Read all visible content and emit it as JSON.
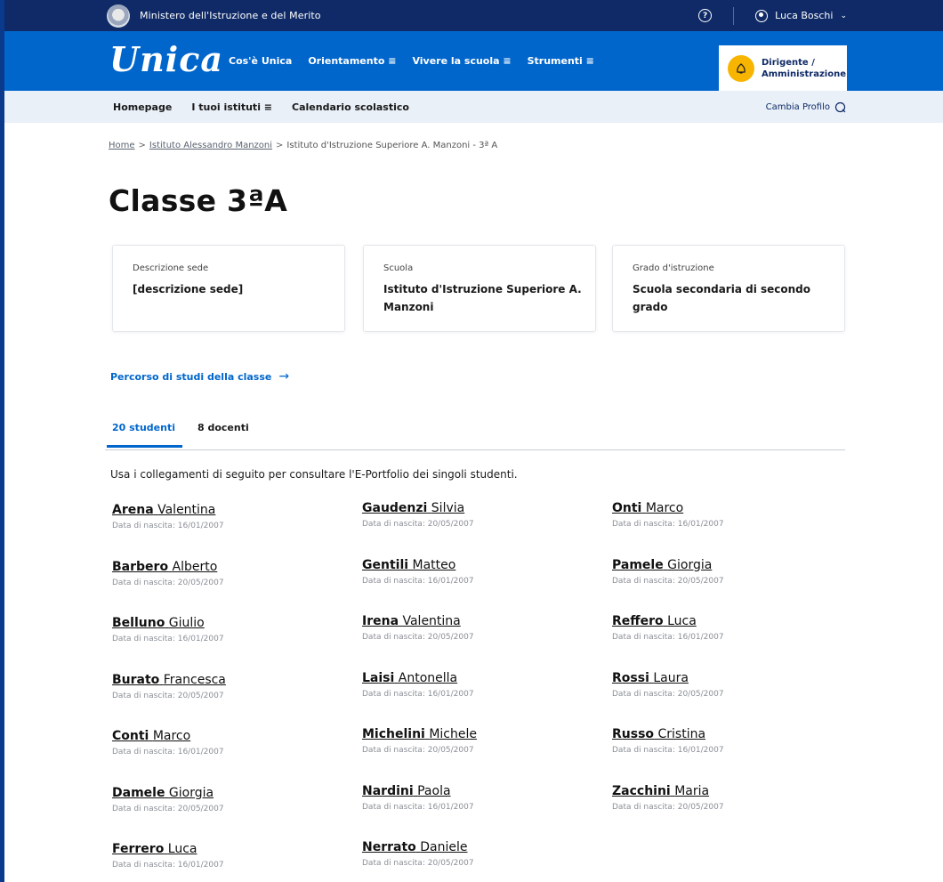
{
  "topbar": {
    "ministry": "Ministero dell'Istruzione e del Merito",
    "help_icon": "?",
    "user": "Luca Boschi",
    "user_chevron": "⌄"
  },
  "header": {
    "logo": "Unica",
    "nav": [
      "Cos'è Unica",
      "Orientamento ≡",
      "Vivere la scuola ≡",
      "Strumenti ≡"
    ],
    "profile_line1": "Dirigente /",
    "profile_line2": "Amministrazione"
  },
  "subnav": {
    "items": [
      "Homepage",
      "I tuoi istituti ≡",
      "Calendario scolastico"
    ],
    "cambia": "Cambia Profilo"
  },
  "breadcrumb": {
    "home": "Home",
    "istituto": "Istituto Alessandro Manzoni",
    "current": "Istituto d'Istruzione Superiore A. Manzoni - 3ª A",
    "sep": ">"
  },
  "page_title": "Classe 3ªA",
  "cards": [
    {
      "label": "Descrizione sede",
      "value": "[descrizione sede]"
    },
    {
      "label": "Scuola",
      "value": "Istituto d'Istruzione Superiore A. Manzoni"
    },
    {
      "label": "Grado d'istruzione",
      "value": "Scuola secondaria di secondo grado"
    }
  ],
  "percorso": {
    "label": "Percorso di studi della classe",
    "arrow": "→"
  },
  "tabs": {
    "students": "20 studenti",
    "teachers": "8 docenti"
  },
  "intro": "Usa i collegamenti di seguito per consultare l'E-Portfolio dei singoli studenti.",
  "students": {
    "col1": [
      {
        "surname": "Arena",
        "name": "Valentina",
        "dob": "Data di nascita: 16/01/2007"
      },
      {
        "surname": "Barbero",
        "name": "Alberto",
        "dob": "Data di nascita: 20/05/2007"
      },
      {
        "surname": "Belluno",
        "name": "Giulio",
        "dob": "Data di nascita: 16/01/2007"
      },
      {
        "surname": "Burato",
        "name": "Francesca",
        "dob": "Data di nascita: 20/05/2007"
      },
      {
        "surname": "Conti",
        "name": "Marco",
        "dob": "Data di nascita: 16/01/2007"
      },
      {
        "surname": "Damele",
        "name": "Giorgia",
        "dob": "Data di nascita: 20/05/2007"
      },
      {
        "surname": "Ferrero",
        "name": "Luca",
        "dob": "Data di nascita: 16/01/2007"
      }
    ],
    "col2": [
      {
        "surname": "Gaudenzi",
        "name": "Silvia",
        "dob": "Data di nascita: 20/05/2007"
      },
      {
        "surname": "Gentili",
        "name": "Matteo",
        "dob": "Data di nascita: 16/01/2007"
      },
      {
        "surname": "Irena",
        "name": "Valentina",
        "dob": "Data di nascita: 20/05/2007"
      },
      {
        "surname": "Laisi",
        "name": "Antonella",
        "dob": "Data di nascita: 16/01/2007"
      },
      {
        "surname": "Michelini",
        "name": "Michele",
        "dob": "Data di nascita: 20/05/2007"
      },
      {
        "surname": "Nardini",
        "name": "Paola",
        "dob": "Data di nascita: 16/01/2007"
      },
      {
        "surname": "Nerrato",
        "name": "Daniele",
        "dob": "Data di nascita: 20/05/2007"
      }
    ],
    "col3": [
      {
        "surname": "Onti",
        "name": "Marco",
        "dob": "Data di nascita: 16/01/2007"
      },
      {
        "surname": "Pamele",
        "name": "Giorgia",
        "dob": "Data di nascita: 20/05/2007"
      },
      {
        "surname": "Reffero",
        "name": "Luca",
        "dob": "Data di nascita: 16/01/2007"
      },
      {
        "surname": "Rossi",
        "name": "Laura",
        "dob": "Data di nascita: 20/05/2007"
      },
      {
        "surname": "Russo",
        "name": "Cristina",
        "dob": "Data di nascita: 16/01/2007"
      },
      {
        "surname": "Zacchini",
        "name": "Maria",
        "dob": "Data di nascita: 20/05/2007"
      }
    ]
  },
  "colors": {
    "top_bar": "#0f2a66",
    "header": "#0066cc",
    "subnav": "#e9f0f8",
    "accent": "#0066cc",
    "profile_badge": "#f7b500"
  }
}
